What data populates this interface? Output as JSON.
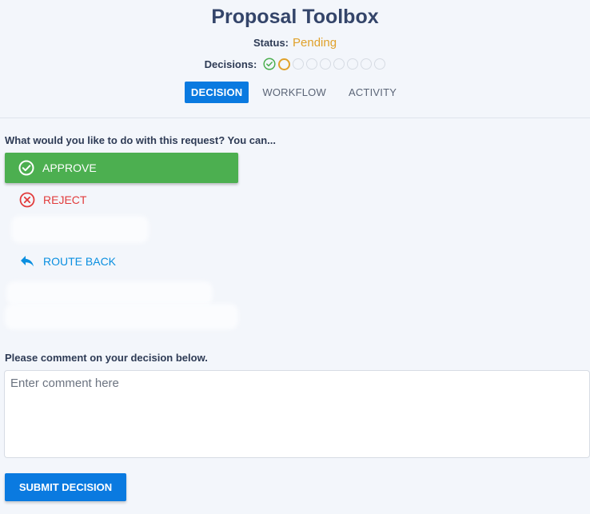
{
  "header": {
    "title": "Proposal Toolbox",
    "status_label": "Status:",
    "status_value": "Pending",
    "decisions_label": "Decisions:"
  },
  "decisions": [
    "done",
    "current",
    "pending",
    "pending",
    "pending",
    "pending",
    "pending",
    "pending",
    "pending"
  ],
  "tabs": [
    {
      "label": "DECISION",
      "active": true
    },
    {
      "label": "WORKFLOW",
      "active": false
    },
    {
      "label": "ACTIVITY",
      "active": false
    }
  ],
  "decision_form": {
    "question": "What would you like to do with this request? You can...",
    "options": [
      {
        "label": "APPROVE",
        "icon": "check-circle-icon"
      },
      {
        "label": "REJECT",
        "icon": "x-circle-icon"
      },
      {
        "label": "ROUTE BACK",
        "icon": "reply-arrow-icon"
      }
    ],
    "comment_label": "Please comment on your decision below.",
    "comment_placeholder": "Enter comment here",
    "comment_value": "",
    "submit_label": "SUBMIT DECISION"
  },
  "colors": {
    "primary": "#0a7ae0",
    "approve": "#4caf50",
    "reject": "#e23b3b",
    "route_back": "#0a8fe0",
    "pending": "#e0a12a",
    "title": "#34456a"
  }
}
